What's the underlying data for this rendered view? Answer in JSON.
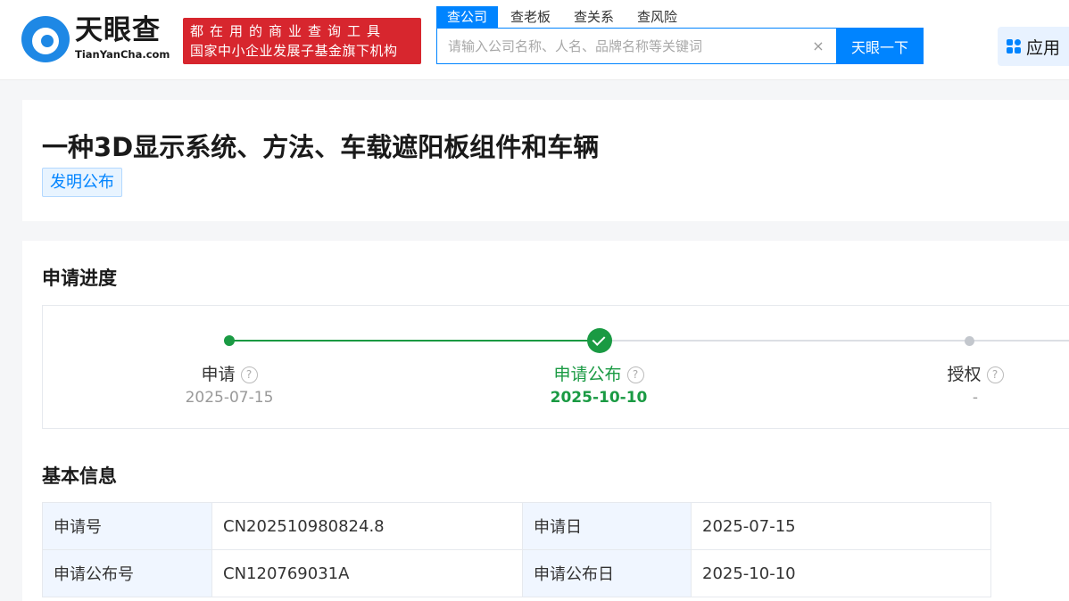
{
  "header": {
    "logo_cn": "天眼查",
    "logo_en": "TianYanCha.com",
    "slogan_line1": "都在用的商业查询工具",
    "slogan_line2": "国家中小企业发展子基金旗下机构",
    "search_tabs": [
      {
        "label": "查公司",
        "active": true
      },
      {
        "label": "查老板",
        "active": false
      },
      {
        "label": "查关系",
        "active": false
      },
      {
        "label": "查风险",
        "active": false
      }
    ],
    "search_placeholder": "请输入公司名称、人名、品牌名称等关键词",
    "search_value": "",
    "clear_symbol": "×",
    "search_button": "天眼一下",
    "apps_label": "应用"
  },
  "patent": {
    "title": "一种3D显示系统、方法、车载遮阳板组件和车辆",
    "status_tag": "发明公布"
  },
  "progress": {
    "section_title": "申请进度",
    "steps": [
      {
        "label": "申请",
        "date": "2025-07-15",
        "state": "done"
      },
      {
        "label": "申请公布",
        "date": "2025-10-10",
        "state": "current"
      },
      {
        "label": "授权",
        "date": "-",
        "state": "pending"
      }
    ],
    "help_symbol": "?"
  },
  "basic_info": {
    "section_title": "基本信息",
    "rows": [
      [
        {
          "k": "申请号",
          "v": "CN202510980824.8"
        },
        {
          "k": "申请日",
          "v": "2025-07-15"
        }
      ],
      [
        {
          "k": "申请公布号",
          "v": "CN120769031A"
        },
        {
          "k": "申请公布日",
          "v": "2025-10-10"
        }
      ]
    ]
  },
  "colors": {
    "brand_blue": "#0084ff",
    "success_green": "#1a9a43",
    "slogan_red": "#d7262e"
  }
}
